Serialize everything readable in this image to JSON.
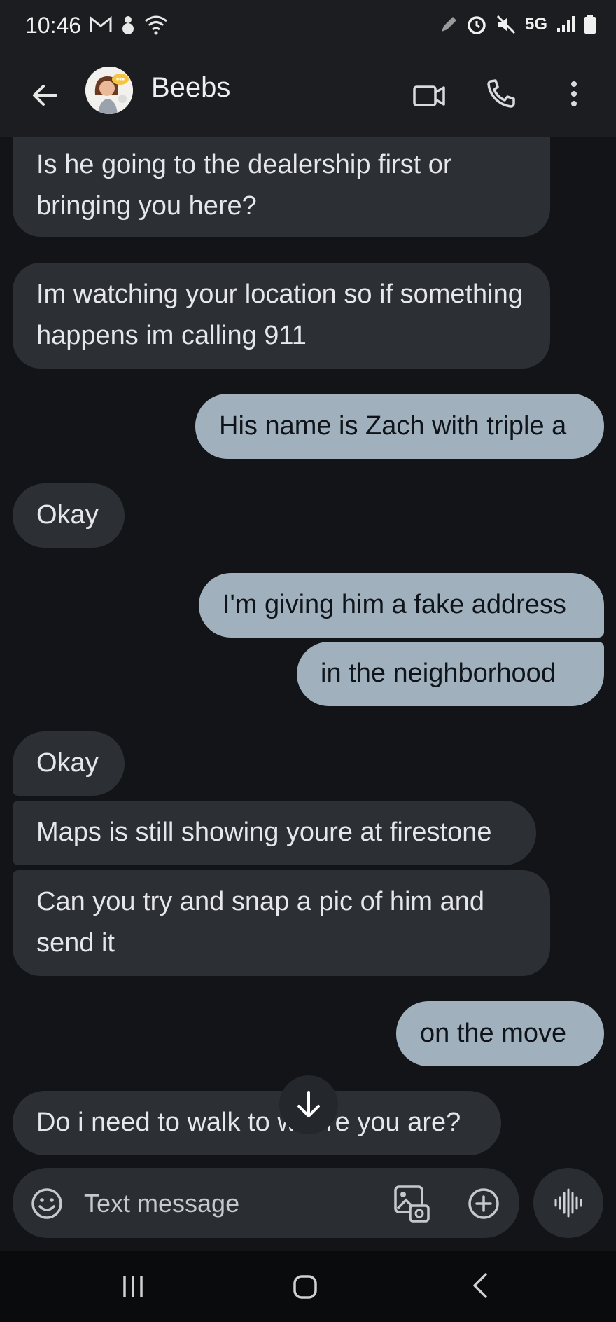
{
  "status_bar": {
    "time": "10:46",
    "network": "5G"
  },
  "contact": {
    "name": "Beebs"
  },
  "messages": [
    {
      "dir": "in",
      "text": "Is he going to the dealership first or bringing you here?"
    },
    {
      "dir": "in",
      "text": "Im watching your location so if something happens im calling 911"
    },
    {
      "dir": "out",
      "text": "His name is Zach with triple a"
    },
    {
      "dir": "in",
      "text": "Okay"
    },
    {
      "dir": "out",
      "text": "I'm giving him a fake address"
    },
    {
      "dir": "out",
      "text": "in the neighborhood"
    },
    {
      "dir": "in",
      "text": "Okay"
    },
    {
      "dir": "in",
      "text": "Maps is still showing youre at firestone"
    },
    {
      "dir": "in",
      "text": "Can you try and snap a pic of him and send it"
    },
    {
      "dir": "out",
      "text": "on the move"
    },
    {
      "dir": "in",
      "text": "Do i need to walk to where you are?"
    }
  ],
  "compose": {
    "placeholder": "Text message"
  },
  "colors": {
    "incoming": "#2c2f34",
    "outgoing": "#a1b0bd",
    "background": "#121417"
  }
}
